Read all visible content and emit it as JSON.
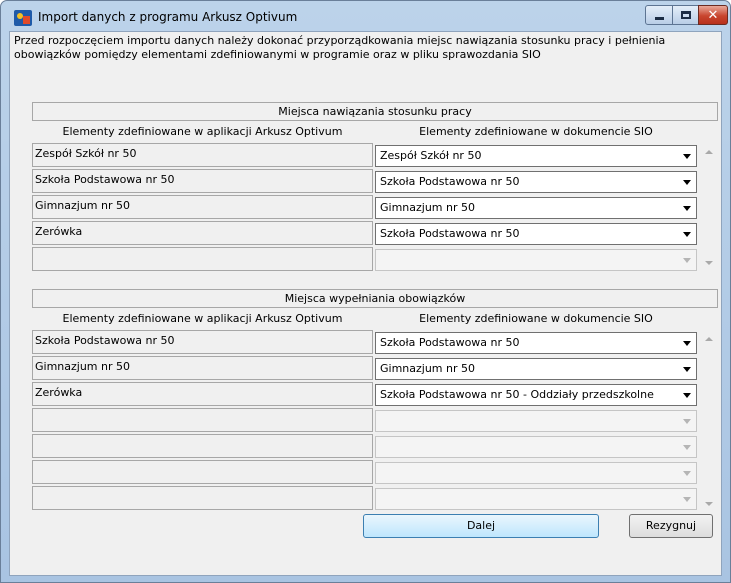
{
  "window": {
    "title": "Import danych z programu Arkusz Optivum",
    "close_glyph": "✕"
  },
  "intro_text": "Przed rozpoczęciem importu danych należy dokonać przyporządkowania miejsc nawiązania stosunku pracy i pełnienia obowiązków pomiędzy elementami zdefiniowanymi w programie oraz w pliku sprawozdania SIO",
  "section1": {
    "title": "Miejsca nawiązania stosunku pracy",
    "left_header": "Elementy zdefiniowane w aplikacji Arkusz Optivum",
    "right_header": "Elementy zdefiniowane w dokumencie SIO",
    "rows": [
      {
        "left": "Zespół Szkół nr 50",
        "right": "Zespół Szkół nr 50"
      },
      {
        "left": "Szkoła Podstawowa nr 50",
        "right": "Szkoła Podstawowa nr 50"
      },
      {
        "left": "Gimnazjum nr 50",
        "right": "Gimnazjum nr 50"
      },
      {
        "left": "Zerówka",
        "right": "Szkoła Podstawowa nr 50"
      },
      {
        "left": "",
        "right": ""
      }
    ]
  },
  "section2": {
    "title": "Miejsca wypełniania obowiązków",
    "left_header": "Elementy zdefiniowane w aplikacji Arkusz Optivum",
    "right_header": "Elementy zdefiniowane w dokumencie SIO",
    "rows": [
      {
        "left": "Szkoła Podstawowa nr 50",
        "right": "Szkoła Podstawowa nr 50"
      },
      {
        "left": "Gimnazjum nr 50",
        "right": "Gimnazjum nr 50"
      },
      {
        "left": "Zerówka",
        "right": "Szkoła Podstawowa nr 50 - Oddziały przedszkolne"
      },
      {
        "left": "",
        "right": ""
      },
      {
        "left": "",
        "right": ""
      },
      {
        "left": "",
        "right": ""
      },
      {
        "left": "",
        "right": ""
      }
    ]
  },
  "buttons": {
    "next": "Dalej",
    "cancel": "Rezygnuj"
  },
  "icons": {
    "app": "app-logo-icon",
    "minimize": "minimize-icon",
    "maximize": "maximize-icon",
    "close": "close-icon",
    "dropdown": "chevron-down-icon",
    "scroll_up": "scroll-up-icon",
    "scroll_down": "scroll-down-icon"
  },
  "colors": {
    "titlebar": "#bcd3ea",
    "close_button": "#c8452e",
    "default_button": "#bee6fd"
  }
}
